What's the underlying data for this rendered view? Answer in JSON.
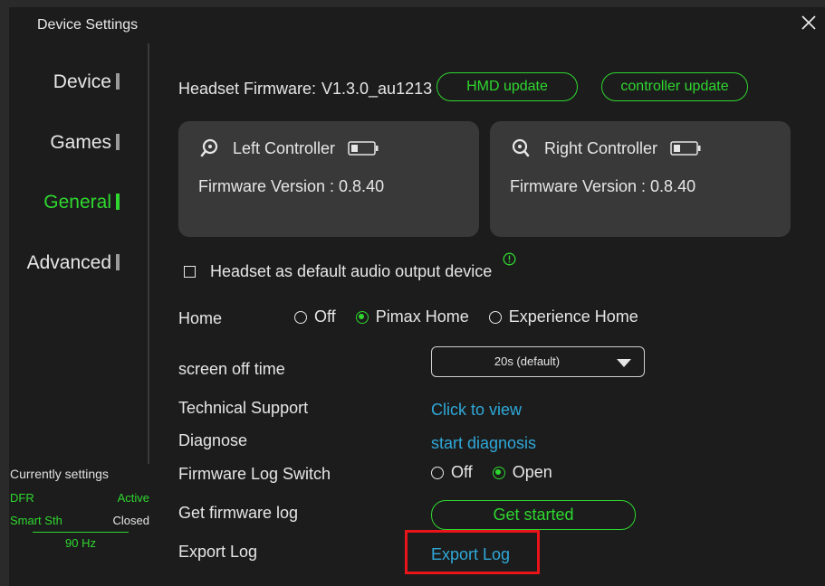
{
  "window": {
    "title": "Device Settings",
    "close_icon": "close-icon"
  },
  "sidebar": {
    "items": [
      {
        "label": "Device",
        "active": false
      },
      {
        "label": "Games",
        "active": false
      },
      {
        "label": "General",
        "active": true
      },
      {
        "label": "Advanced",
        "active": false
      }
    ]
  },
  "status": {
    "title": "Currently settings",
    "rows": [
      {
        "key": "DFR",
        "value": "Active"
      },
      {
        "key": "Smart Sth",
        "value": "Closed"
      }
    ],
    "refresh": "90 Hz"
  },
  "firmware": {
    "label": "Headset Firmware:",
    "version": "V1.3.0_au1213",
    "hmd_update": "HMD update",
    "controller_update": "controller update"
  },
  "controllers": {
    "left": {
      "name": "Left Controller",
      "firmware": "Firmware Version : 0.8.40"
    },
    "right": {
      "name": "Right Controller",
      "firmware": "Firmware Version : 0.8.40"
    }
  },
  "audio": {
    "label": "Headset as default audio output device",
    "checked": false
  },
  "home": {
    "label": "Home",
    "options": [
      "Off",
      "Pimax Home",
      "Experience Home"
    ],
    "selected": "Pimax Home"
  },
  "screen_off": {
    "label": "screen off time",
    "value": "20s (default)"
  },
  "tech_support": {
    "label": "Technical Support",
    "link": "Click to view"
  },
  "diagnose": {
    "label": "Diagnose",
    "link": "start diagnosis"
  },
  "fw_log_switch": {
    "label": "Firmware Log Switch",
    "options": [
      "Off",
      "Open"
    ],
    "selected": "Open"
  },
  "get_fw_log": {
    "label": "Get firmware log",
    "button": "Get started"
  },
  "export_log": {
    "label": "Export Log",
    "link": "Export Log"
  },
  "colors": {
    "accent": "#2fd72f",
    "link": "#2fa8d8",
    "highlight": "#e8141a",
    "card": "#393939"
  }
}
